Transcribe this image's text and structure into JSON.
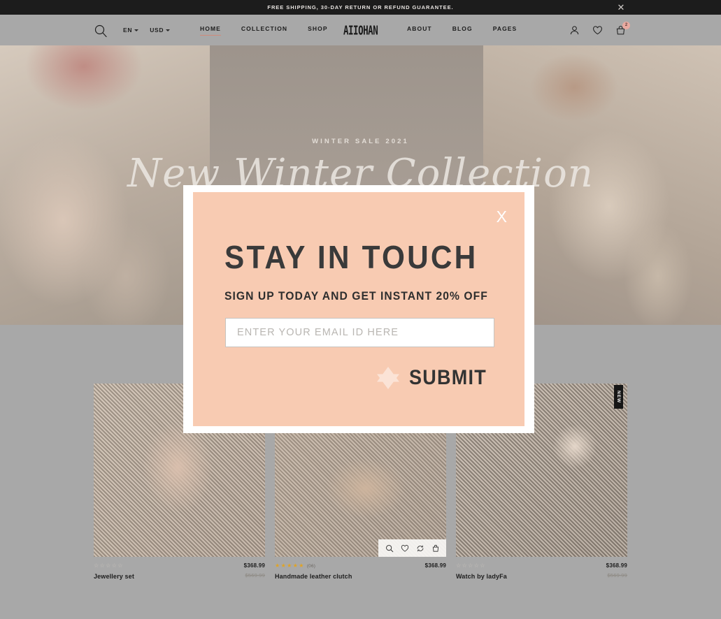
{
  "announcement": {
    "text": "FREE SHIPPING, 30-DAY RETURN OR REFUND GUARANTEE.",
    "close_label": "✕"
  },
  "header": {
    "logo": "AIIOHAN",
    "search_icon": "search-icon",
    "selectors": [
      {
        "label": "EN",
        "name": "language-selector"
      },
      {
        "label": "USD",
        "name": "currency-selector"
      }
    ],
    "nav_left": [
      {
        "label": "HOME",
        "active": true
      },
      {
        "label": "COLLECTION",
        "active": false
      },
      {
        "label": "SHOP",
        "active": false
      }
    ],
    "nav_right": [
      {
        "label": "ABOUT",
        "active": false
      },
      {
        "label": "BLOG",
        "active": false
      },
      {
        "label": "PAGES",
        "active": false
      }
    ],
    "icons": [
      {
        "name": "account-icon"
      },
      {
        "name": "wishlist-heart-icon"
      },
      {
        "name": "cart-bag-icon"
      }
    ],
    "cart_count": "2"
  },
  "hero": {
    "kicker": "WINTER SALE 2021",
    "title": "New Winter Collection"
  },
  "modal": {
    "close_label": "X",
    "title": "STAY IN TOUCH",
    "subtitle": "SIGN UP TODAY AND GET INSTANT 20% OFF",
    "email_placeholder": "ENTER YOUR EMAIL ID HERE",
    "email_value": "",
    "submit_label": "SUBMIT",
    "star_icon": "six-point-star-icon",
    "bg_color": "#f8cbb2",
    "text_color": "#3a3a3a"
  },
  "products": [
    {
      "name": "Jewellery set",
      "price": "$368.99",
      "old_price": "$569.99",
      "rating": 0,
      "reviews": "",
      "badge": "",
      "hover_actions": []
    },
    {
      "name": "Handmade leather clutch",
      "price": "$368.99",
      "old_price": "",
      "rating": 5,
      "reviews": "(06)",
      "badge": "",
      "hover_actions": [
        {
          "name": "quick-view-icon"
        },
        {
          "name": "wishlist-heart-icon"
        },
        {
          "name": "compare-icon"
        },
        {
          "name": "add-to-cart-icon"
        }
      ]
    },
    {
      "name": "Watch by ladyFa",
      "price": "$368.99",
      "old_price": "$569.99",
      "rating": 0,
      "reviews": "",
      "badge": "NEW",
      "hover_actions": []
    }
  ]
}
